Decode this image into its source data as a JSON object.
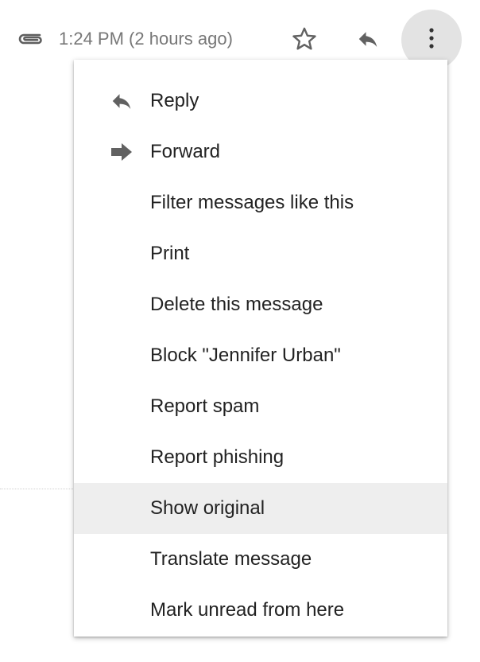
{
  "header": {
    "timestamp": "1:24 PM (2 hours ago)",
    "icons": {
      "attachment": "paperclip-icon",
      "star": "star-outline-icon",
      "reply": "reply-arrow-icon",
      "more": "vertical-dots-icon"
    }
  },
  "menu": {
    "items": [
      {
        "label": "Reply",
        "icon": "reply-icon"
      },
      {
        "label": "Forward",
        "icon": "forward-icon"
      },
      {
        "label": "Filter messages like this"
      },
      {
        "label": "Print"
      },
      {
        "label": "Delete this message"
      },
      {
        "label": "Block \"Jennifer Urban\""
      },
      {
        "label": "Report spam"
      },
      {
        "label": "Report phishing"
      },
      {
        "label": "Show original",
        "highlighted": true
      },
      {
        "label": "Translate message"
      },
      {
        "label": "Mark unread from here"
      }
    ]
  },
  "colors": {
    "icon_gray": "#616161",
    "text": "#222222",
    "muted_text": "#777777",
    "hover_bg": "#eeeeee",
    "more_button_bg": "#e3e3e3"
  }
}
